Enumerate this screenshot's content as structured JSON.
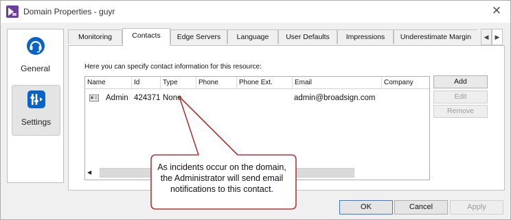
{
  "window": {
    "title": "Domain Properties - guyr",
    "close_glyph": "✕"
  },
  "nav": [
    {
      "label": "General",
      "icon": "headset-icon",
      "selected": false
    },
    {
      "label": "Settings",
      "icon": "settings-panel-icon",
      "selected": true
    }
  ],
  "tabs": [
    "Monitoring",
    "Contacts",
    "Edge Servers",
    "Language",
    "User Defaults",
    "Impressions",
    "Underestimate Margin"
  ],
  "active_tab": "Contacts",
  "contacts": {
    "intro": "Here you can specify contact information for this resource:",
    "columns": [
      "Name",
      "Id",
      "Type",
      "Phone",
      "Phone Ext.",
      "Email",
      "Company"
    ],
    "rows": [
      {
        "name": "Admin",
        "id": "424371",
        "type": "None",
        "phone": "",
        "phone_ext": "",
        "email": "admin@broadsign.com",
        "company": ""
      }
    ],
    "buttons": {
      "add": "Add",
      "edit": "Edit",
      "remove": "Remove"
    }
  },
  "footer": {
    "ok": "OK",
    "cancel": "Cancel",
    "apply": "Apply"
  },
  "callout": {
    "line1": "As incidents occur on the domain,",
    "line2": "the Administrator will send email",
    "line3": "notifications to this contact."
  },
  "colors": {
    "callout_border": "#b23434",
    "accent": "#0a63c9",
    "app_icon": "#6b3fa0"
  }
}
